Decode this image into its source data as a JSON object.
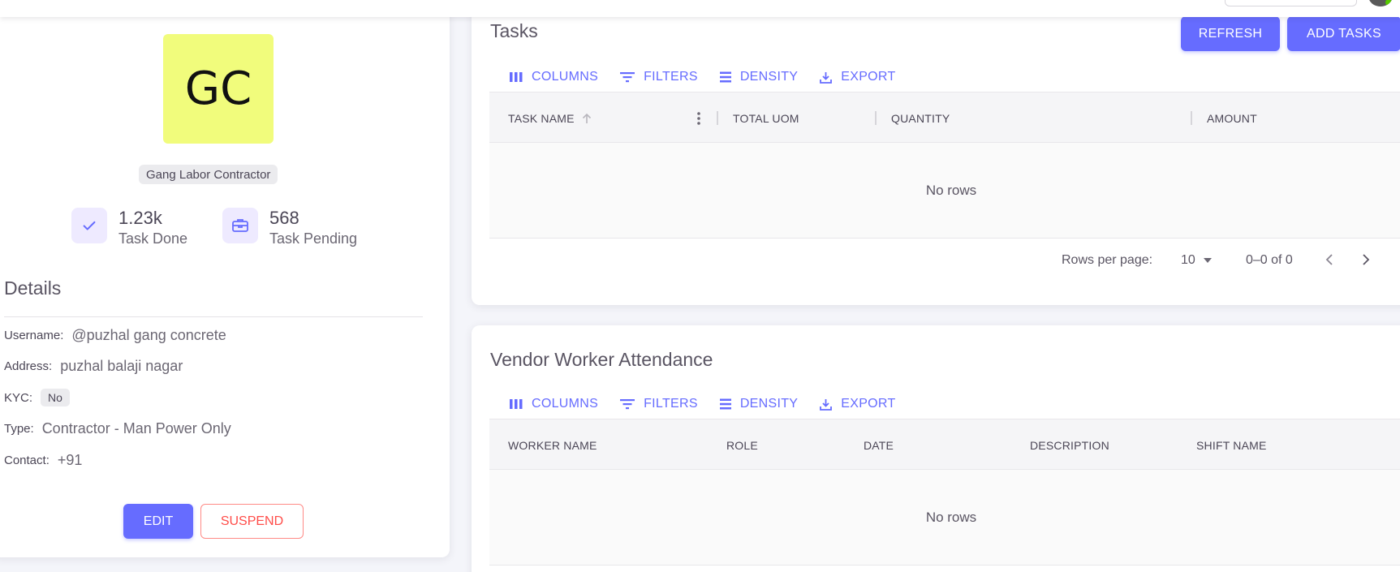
{
  "profile": {
    "initials": "GC",
    "avatar_color": "#f1fc7c",
    "role": "Gang Labor Contractor",
    "stats": [
      {
        "value": "1.23k",
        "label": "Task Done",
        "icon": "check-icon"
      },
      {
        "value": "568",
        "label": "Task Pending",
        "icon": "briefcase-icon"
      }
    ],
    "details_title": "Details",
    "details": {
      "username_label": "Username:",
      "username_value": "@puzhal gang concrete",
      "address_label": "Address:",
      "address_value": "puzhal balaji nagar",
      "kyc_label": "KYC:",
      "kyc_value": "No",
      "type_label": "Type:",
      "type_value": "Contractor - Man Power Only",
      "contact_label": "Contact:",
      "contact_value": "+91"
    },
    "edit_label": "EDIT",
    "suspend_label": "SUSPEND"
  },
  "tasks": {
    "title": "Tasks",
    "refresh_label": "REFRESH",
    "add_label": "ADD TASKS",
    "toolbar": {
      "columns": "COLUMNS",
      "filters": "FILTERS",
      "density": "DENSITY",
      "export": "EXPORT"
    },
    "columns": [
      "TASK NAME",
      "TOTAL UOM",
      "QUANTITY",
      "AMOUNT"
    ],
    "empty": "No rows",
    "rows_per_page_label": "Rows per page:",
    "rows_per_page_value": "10",
    "range": "0–0 of 0"
  },
  "attendance": {
    "title": "Vendor Worker Attendance",
    "toolbar": {
      "columns": "COLUMNS",
      "filters": "FILTERS",
      "density": "DENSITY",
      "export": "EXPORT"
    },
    "columns": [
      "WORKER NAME",
      "ROLE",
      "DATE",
      "DESCRIPTION",
      "SHIFT NAME"
    ],
    "empty": "No rows"
  },
  "colors": {
    "primary": "#666cff",
    "error": "#ff4d49"
  }
}
